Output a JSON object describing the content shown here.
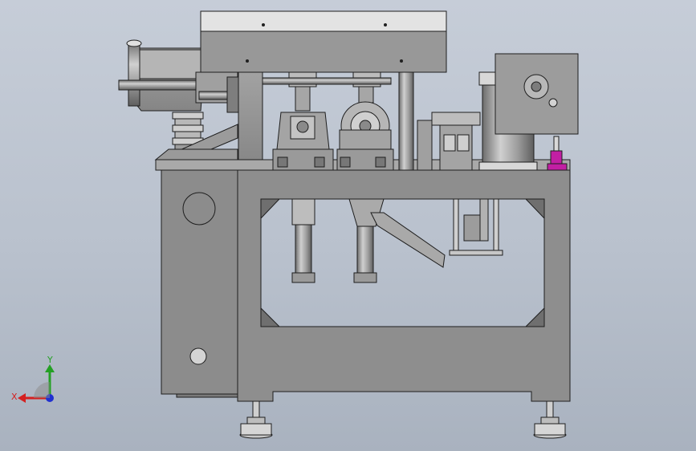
{
  "viewport": {
    "background": "#bfc6d1",
    "part_color": "#8f8f8f",
    "edge_color": "#1e1e1e",
    "highlight_color": "#a8a8a8",
    "accent_magenta": "#c21fa3"
  },
  "triad": {
    "x_label": "X",
    "y_label": "Y",
    "x_color": "#d42020",
    "y_color": "#24a024",
    "z_color": "#2030d0"
  }
}
